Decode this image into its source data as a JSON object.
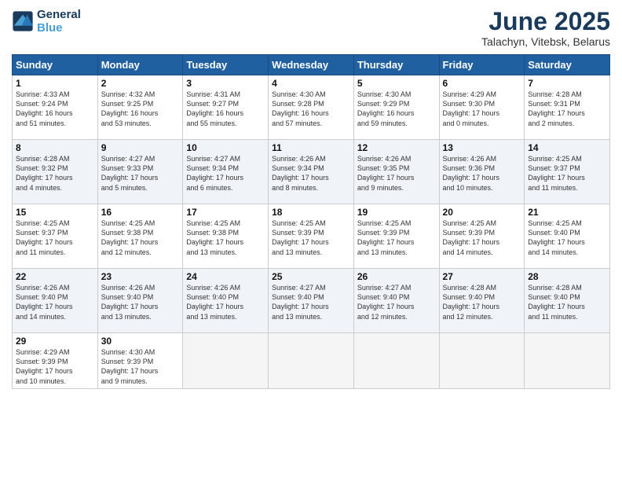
{
  "header": {
    "logo_line1": "General",
    "logo_line2": "Blue",
    "title": "June 2025",
    "subtitle": "Talachyn, Vitebsk, Belarus"
  },
  "weekdays": [
    "Sunday",
    "Monday",
    "Tuesday",
    "Wednesday",
    "Thursday",
    "Friday",
    "Saturday"
  ],
  "weeks": [
    [
      {
        "day": "1",
        "info": "Sunrise: 4:33 AM\nSunset: 9:24 PM\nDaylight: 16 hours\nand 51 minutes."
      },
      {
        "day": "2",
        "info": "Sunrise: 4:32 AM\nSunset: 9:25 PM\nDaylight: 16 hours\nand 53 minutes."
      },
      {
        "day": "3",
        "info": "Sunrise: 4:31 AM\nSunset: 9:27 PM\nDaylight: 16 hours\nand 55 minutes."
      },
      {
        "day": "4",
        "info": "Sunrise: 4:30 AM\nSunset: 9:28 PM\nDaylight: 16 hours\nand 57 minutes."
      },
      {
        "day": "5",
        "info": "Sunrise: 4:30 AM\nSunset: 9:29 PM\nDaylight: 16 hours\nand 59 minutes."
      },
      {
        "day": "6",
        "info": "Sunrise: 4:29 AM\nSunset: 9:30 PM\nDaylight: 17 hours\nand 0 minutes."
      },
      {
        "day": "7",
        "info": "Sunrise: 4:28 AM\nSunset: 9:31 PM\nDaylight: 17 hours\nand 2 minutes."
      }
    ],
    [
      {
        "day": "8",
        "info": "Sunrise: 4:28 AM\nSunset: 9:32 PM\nDaylight: 17 hours\nand 4 minutes."
      },
      {
        "day": "9",
        "info": "Sunrise: 4:27 AM\nSunset: 9:33 PM\nDaylight: 17 hours\nand 5 minutes."
      },
      {
        "day": "10",
        "info": "Sunrise: 4:27 AM\nSunset: 9:34 PM\nDaylight: 17 hours\nand 6 minutes."
      },
      {
        "day": "11",
        "info": "Sunrise: 4:26 AM\nSunset: 9:34 PM\nDaylight: 17 hours\nand 8 minutes."
      },
      {
        "day": "12",
        "info": "Sunrise: 4:26 AM\nSunset: 9:35 PM\nDaylight: 17 hours\nand 9 minutes."
      },
      {
        "day": "13",
        "info": "Sunrise: 4:26 AM\nSunset: 9:36 PM\nDaylight: 17 hours\nand 10 minutes."
      },
      {
        "day": "14",
        "info": "Sunrise: 4:25 AM\nSunset: 9:37 PM\nDaylight: 17 hours\nand 11 minutes."
      }
    ],
    [
      {
        "day": "15",
        "info": "Sunrise: 4:25 AM\nSunset: 9:37 PM\nDaylight: 17 hours\nand 11 minutes."
      },
      {
        "day": "16",
        "info": "Sunrise: 4:25 AM\nSunset: 9:38 PM\nDaylight: 17 hours\nand 12 minutes."
      },
      {
        "day": "17",
        "info": "Sunrise: 4:25 AM\nSunset: 9:38 PM\nDaylight: 17 hours\nand 13 minutes."
      },
      {
        "day": "18",
        "info": "Sunrise: 4:25 AM\nSunset: 9:39 PM\nDaylight: 17 hours\nand 13 minutes."
      },
      {
        "day": "19",
        "info": "Sunrise: 4:25 AM\nSunset: 9:39 PM\nDaylight: 17 hours\nand 13 minutes."
      },
      {
        "day": "20",
        "info": "Sunrise: 4:25 AM\nSunset: 9:39 PM\nDaylight: 17 hours\nand 14 minutes."
      },
      {
        "day": "21",
        "info": "Sunrise: 4:25 AM\nSunset: 9:40 PM\nDaylight: 17 hours\nand 14 minutes."
      }
    ],
    [
      {
        "day": "22",
        "info": "Sunrise: 4:26 AM\nSunset: 9:40 PM\nDaylight: 17 hours\nand 14 minutes."
      },
      {
        "day": "23",
        "info": "Sunrise: 4:26 AM\nSunset: 9:40 PM\nDaylight: 17 hours\nand 13 minutes."
      },
      {
        "day": "24",
        "info": "Sunrise: 4:26 AM\nSunset: 9:40 PM\nDaylight: 17 hours\nand 13 minutes."
      },
      {
        "day": "25",
        "info": "Sunrise: 4:27 AM\nSunset: 9:40 PM\nDaylight: 17 hours\nand 13 minutes."
      },
      {
        "day": "26",
        "info": "Sunrise: 4:27 AM\nSunset: 9:40 PM\nDaylight: 17 hours\nand 12 minutes."
      },
      {
        "day": "27",
        "info": "Sunrise: 4:28 AM\nSunset: 9:40 PM\nDaylight: 17 hours\nand 12 minutes."
      },
      {
        "day": "28",
        "info": "Sunrise: 4:28 AM\nSunset: 9:40 PM\nDaylight: 17 hours\nand 11 minutes."
      }
    ],
    [
      {
        "day": "29",
        "info": "Sunrise: 4:29 AM\nSunset: 9:39 PM\nDaylight: 17 hours\nand 10 minutes."
      },
      {
        "day": "30",
        "info": "Sunrise: 4:30 AM\nSunset: 9:39 PM\nDaylight: 17 hours\nand 9 minutes."
      },
      {
        "day": "",
        "info": ""
      },
      {
        "day": "",
        "info": ""
      },
      {
        "day": "",
        "info": ""
      },
      {
        "day": "",
        "info": ""
      },
      {
        "day": "",
        "info": ""
      }
    ]
  ]
}
